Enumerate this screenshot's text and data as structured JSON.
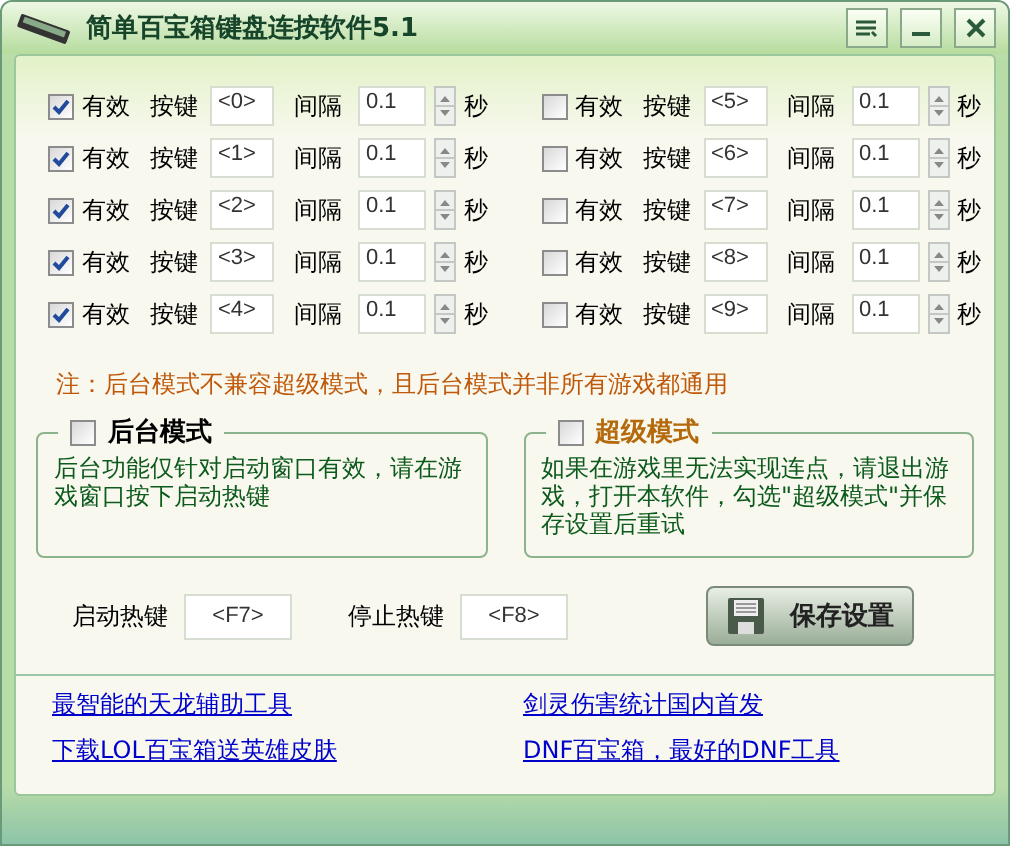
{
  "window": {
    "title": "简单百宝箱键盘连按软件5.1"
  },
  "keys": [
    {
      "enabled": true,
      "enabled_label": "有效",
      "key_label": "按键",
      "key": "<0>",
      "interval_label": "间隔",
      "interval": "0.1",
      "unit": "秒"
    },
    {
      "enabled": true,
      "enabled_label": "有效",
      "key_label": "按键",
      "key": "<1>",
      "interval_label": "间隔",
      "interval": "0.1",
      "unit": "秒"
    },
    {
      "enabled": true,
      "enabled_label": "有效",
      "key_label": "按键",
      "key": "<2>",
      "interval_label": "间隔",
      "interval": "0.1",
      "unit": "秒"
    },
    {
      "enabled": true,
      "enabled_label": "有效",
      "key_label": "按键",
      "key": "<3>",
      "interval_label": "间隔",
      "interval": "0.1",
      "unit": "秒"
    },
    {
      "enabled": true,
      "enabled_label": "有效",
      "key_label": "按键",
      "key": "<4>",
      "interval_label": "间隔",
      "interval": "0.1",
      "unit": "秒"
    },
    {
      "enabled": false,
      "enabled_label": "有效",
      "key_label": "按键",
      "key": "<5>",
      "interval_label": "间隔",
      "interval": "0.1",
      "unit": "秒"
    },
    {
      "enabled": false,
      "enabled_label": "有效",
      "key_label": "按键",
      "key": "<6>",
      "interval_label": "间隔",
      "interval": "0.1",
      "unit": "秒"
    },
    {
      "enabled": false,
      "enabled_label": "有效",
      "key_label": "按键",
      "key": "<7>",
      "interval_label": "间隔",
      "interval": "0.1",
      "unit": "秒"
    },
    {
      "enabled": false,
      "enabled_label": "有效",
      "key_label": "按键",
      "key": "<8>",
      "interval_label": "间隔",
      "interval": "0.1",
      "unit": "秒"
    },
    {
      "enabled": false,
      "enabled_label": "有效",
      "key_label": "按键",
      "key": "<9>",
      "interval_label": "间隔",
      "interval": "0.1",
      "unit": "秒"
    }
  ],
  "note": "注：后台模式不兼容超级模式，且后台模式并非所有游戏都通用",
  "modes": [
    {
      "label": "后台模式",
      "checked": false,
      "highlight": false,
      "text": "后台功能仅针对启动窗口有效，请在游戏窗口按下启动热键"
    },
    {
      "label": "超级模式",
      "checked": false,
      "highlight": true,
      "text": "如果在游戏里无法实现连点，请退出游戏，打开本软件，勾选\"超级模式\"并保存设置后重试"
    }
  ],
  "hotkeys": [
    {
      "label": "启动热键",
      "value": "<F7>"
    },
    {
      "label": "停止热键",
      "value": "<F8>"
    }
  ],
  "save_button": "保存设置",
  "links": [
    "最智能的天龙辅助工具",
    "剑灵伤害统计国内首发",
    "下载LOL百宝箱送英雄皮肤",
    "DNF百宝箱，最好的DNF工具"
  ]
}
